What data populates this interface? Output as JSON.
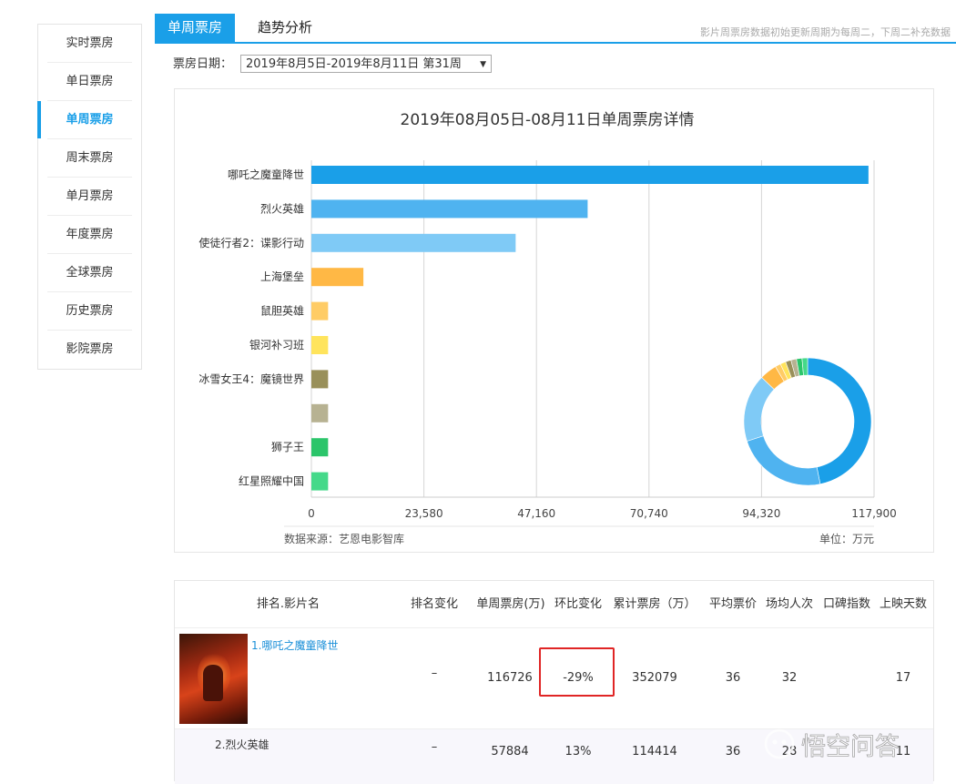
{
  "sidebar": {
    "items": [
      {
        "label": "实时票房",
        "active": false
      },
      {
        "label": "单日票房",
        "active": false
      },
      {
        "label": "单周票房",
        "active": true
      },
      {
        "label": "周末票房",
        "active": false
      },
      {
        "label": "单月票房",
        "active": false
      },
      {
        "label": "年度票房",
        "active": false
      },
      {
        "label": "全球票房",
        "active": false
      },
      {
        "label": "历史票房",
        "active": false
      },
      {
        "label": "影院票房",
        "active": false
      }
    ]
  },
  "tabs": {
    "active": "单周票房",
    "second": "趋势分析",
    "note": "影片周票房数据初始更新周期为每周二，下周二补充数据"
  },
  "date": {
    "label": "票房日期：",
    "selected": "2019年8月5日-2019年8月11日 第31周"
  },
  "colors": {
    "accent": "#1a9fe8",
    "highlight": "#e02525"
  },
  "chart_data": {
    "type": "bar",
    "orientation": "horizontal",
    "title": "2019年08月05日-08月11日单周票房详情",
    "categories": [
      "哪吒之魔童降世",
      "烈火英雄",
      "使徒行者2：谍影行动",
      "上海堡垒",
      "鼠胆英雄",
      "银河补习班",
      "冰雪女王4：魔镜世界",
      "",
      "狮子王",
      "红星照耀中国"
    ],
    "values": [
      116726,
      57884,
      42800,
      10900,
      3500,
      3500,
      3500,
      3500,
      3500,
      3500
    ],
    "colors": [
      "#1a9fe8",
      "#4fb3f0",
      "#7fcaf6",
      "#ffb845",
      "#ffcc66",
      "#ffe45c",
      "#99905a",
      "#b7b292",
      "#2bc56a",
      "#45d98a"
    ],
    "xticks": [
      0,
      23580,
      47160,
      70740,
      94320,
      117900
    ],
    "xtick_labels": [
      "0",
      "23,580",
      "47,160",
      "70,740",
      "94,320",
      "117,900"
    ],
    "xlim": [
      0,
      117900
    ],
    "grid": true,
    "source": "数据来源：艺恩电影智库",
    "unit": "单位：万元",
    "donut": {
      "type": "pie",
      "values": [
        116726,
        57884,
        42800,
        10900,
        3500,
        3500,
        3500,
        3500,
        3500,
        3500
      ],
      "colors": [
        "#1a9fe8",
        "#4fb3f0",
        "#7fcaf6",
        "#ffb845",
        "#ffcc66",
        "#ffe45c",
        "#99905a",
        "#b7b292",
        "#2bc56a",
        "#45d98a"
      ]
    }
  },
  "table": {
    "headers": [
      "排名.影片名",
      "排名变化",
      "单周票房(万)",
      "环比变化",
      "累计票房（万）",
      "平均票价",
      "场均人次",
      "口碑指数",
      "上映天数"
    ],
    "rows": [
      {
        "name": "1.哪吒之魔童降世",
        "rank_change": "–",
        "weekly": "116726",
        "change": "-29%",
        "total": "352079",
        "avg_price": "36",
        "avg_people": "32",
        "score": "",
        "days": "17"
      },
      {
        "name": "2.烈火英雄",
        "rank_change": "–",
        "weekly": "57884",
        "change": "13%",
        "total": "114414",
        "avg_price": "36",
        "avg_people": "28",
        "score": "",
        "days": "11"
      }
    ]
  },
  "watermark": {
    "text": "悟空问答"
  }
}
